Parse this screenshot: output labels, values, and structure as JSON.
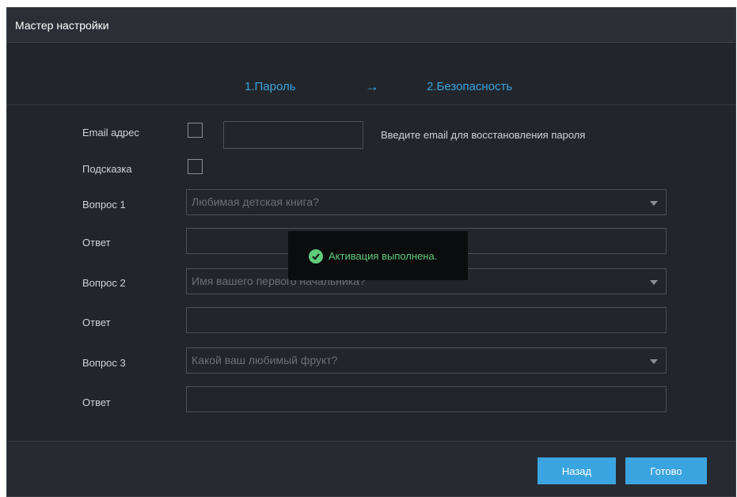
{
  "window": {
    "title": "Мастер настройки"
  },
  "steps": {
    "step1": "1.Пароль",
    "arrow": "→",
    "step2": "2.Безопасность"
  },
  "form": {
    "email_label": "Email адрес",
    "email_hint": "Введите email для восстановления пароля",
    "hint_label": "Подсказка",
    "q1_label": "Вопрос 1",
    "q1_value": "Любимая детская книга?",
    "a1_label": "Ответ",
    "q2_label": "Вопрос 2",
    "q2_value": "Имя вашего первого начальника?",
    "a2_label": "Ответ",
    "q3_label": "Вопрос 3",
    "q3_value": "Какой ваш любимый фрукт?",
    "a3_label": "Ответ"
  },
  "toast": {
    "message": "Активация выполнена.",
    "icon": "check-circle-icon"
  },
  "footer": {
    "back_label": "Назад",
    "done_label": "Готово"
  },
  "colors": {
    "accent": "#3aa4e0",
    "success": "#5fcb7a",
    "background": "#22252a"
  }
}
